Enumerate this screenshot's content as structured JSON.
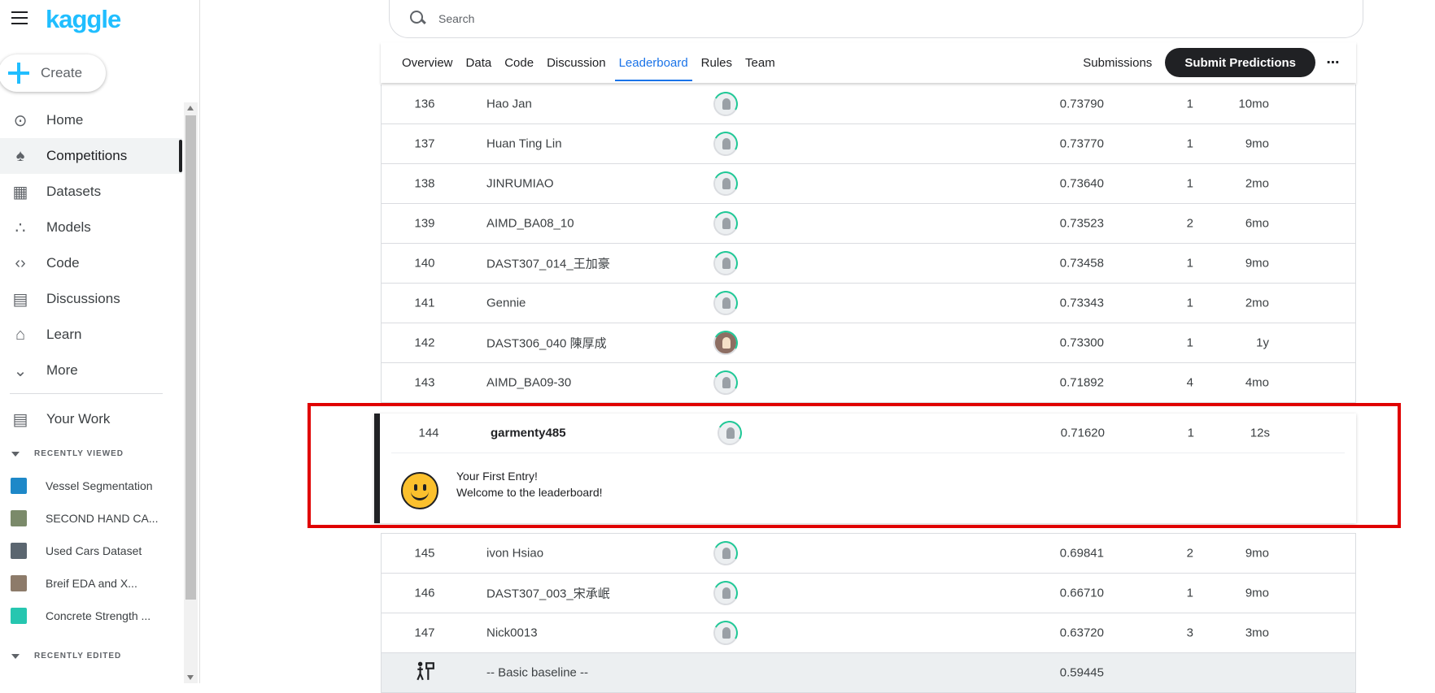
{
  "brand": {
    "logo": "kaggle"
  },
  "create": {
    "label": "Create"
  },
  "nav": [
    {
      "label": "Home",
      "icon": "compass-icon"
    },
    {
      "label": "Competitions",
      "icon": "trophy-icon",
      "active": true
    },
    {
      "label": "Datasets",
      "icon": "table-icon"
    },
    {
      "label": "Models",
      "icon": "models-icon"
    },
    {
      "label": "Code",
      "icon": "code-icon"
    },
    {
      "label": "Discussions",
      "icon": "comments-icon"
    },
    {
      "label": "Learn",
      "icon": "school-icon"
    },
    {
      "label": "More",
      "icon": "chevron-down-icon"
    }
  ],
  "your_work": {
    "label": "Your Work"
  },
  "recently_viewed": {
    "label": "RECENTLY VIEWED",
    "items": [
      {
        "label": "Vessel Segmentation",
        "color": "#1e88c8"
      },
      {
        "label": "SECOND HAND CA...",
        "color": "#7b8a6a"
      },
      {
        "label": "Used Cars Dataset",
        "color": "#5b6670"
      },
      {
        "label": "Breif EDA and X...",
        "color": "#8d7b6a"
      },
      {
        "label": "Concrete Strength ...",
        "color": "#26c6b0"
      }
    ]
  },
  "recently_edited": {
    "label": "RECENTLY EDITED"
  },
  "search": {
    "placeholder": "Search"
  },
  "tabs": [
    "Overview",
    "Data",
    "Code",
    "Discussion",
    "Leaderboard",
    "Rules",
    "Team"
  ],
  "active_tab": "Leaderboard",
  "actions": {
    "submissions": "Submissions",
    "submit": "Submit Predictions",
    "more": "⋯"
  },
  "rows_above": [
    {
      "rank": "136",
      "name": "Hao Jan",
      "score": "0.73790",
      "entries": "1",
      "last": "10mo"
    },
    {
      "rank": "137",
      "name": "Huan Ting Lin",
      "score": "0.73770",
      "entries": "1",
      "last": "9mo"
    },
    {
      "rank": "138",
      "name": "JINRUMIAO",
      "score": "0.73640",
      "entries": "1",
      "last": "2mo"
    },
    {
      "rank": "139",
      "name": "AIMD_BA08_10",
      "score": "0.73523",
      "entries": "2",
      "last": "6mo"
    },
    {
      "rank": "140",
      "name": "DAST307_014_王加豪",
      "score": "0.73458",
      "entries": "1",
      "last": "9mo"
    },
    {
      "rank": "141",
      "name": "Gennie",
      "score": "0.73343",
      "entries": "1",
      "last": "2mo"
    },
    {
      "rank": "142",
      "name": "DAST306_040 陳厚成",
      "score": "0.73300",
      "entries": "1",
      "last": "1y",
      "photo": true
    },
    {
      "rank": "143",
      "name": "AIMD_BA09-30",
      "score": "0.71892",
      "entries": "4",
      "last": "4mo"
    }
  ],
  "my_entry": {
    "rank": "144",
    "name": "garmenty485",
    "score": "0.71620",
    "entries": "1",
    "last": "12s",
    "message_title": "Your First Entry!",
    "message_body": "Welcome to the leaderboard!"
  },
  "rows_below": [
    {
      "rank": "145",
      "name": "ivon Hsiao",
      "score": "0.69841",
      "entries": "2",
      "last": "9mo"
    },
    {
      "rank": "146",
      "name": "DAST307_003_宋承岷",
      "score": "0.66710",
      "entries": "1",
      "last": "9mo"
    },
    {
      "rank": "147",
      "name": "Nick0013",
      "score": "0.63720",
      "entries": "3",
      "last": "3mo"
    }
  ],
  "baseline": {
    "name": "-- Basic baseline --",
    "score": "0.59445"
  }
}
